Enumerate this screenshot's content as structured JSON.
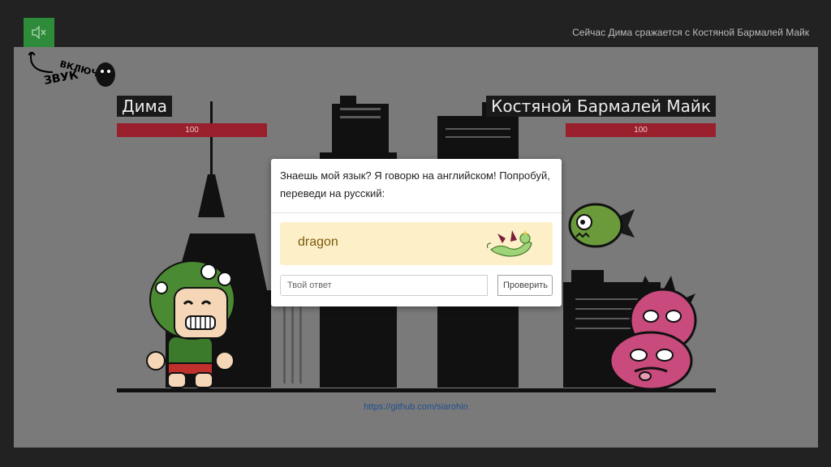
{
  "header": {
    "sound_icon": "speaker-muted-icon",
    "status": "Сейчас Дима сражается с Костяной Бармалей Майк"
  },
  "hint": {
    "text": "ВКЛЮЧИ ЗВУК"
  },
  "player": {
    "name": "Дима",
    "hp": "100"
  },
  "enemy": {
    "name": "Костяной Бармалей Майк",
    "hp": "100"
  },
  "footer": {
    "link": "https://github.com/siarohin"
  },
  "modal": {
    "question": "Знаешь мой язык? Я говорю на английском! Попробуй, переведи на русский:",
    "word": "dragon",
    "answer_placeholder": "Твой ответ",
    "check_label": "Проверить"
  },
  "colors": {
    "stage_bg": "#7a7a7a",
    "hp_bar": "#9a1f2c",
    "sound_button": "#2e8b3a",
    "word_card": "#fdf0c8"
  }
}
